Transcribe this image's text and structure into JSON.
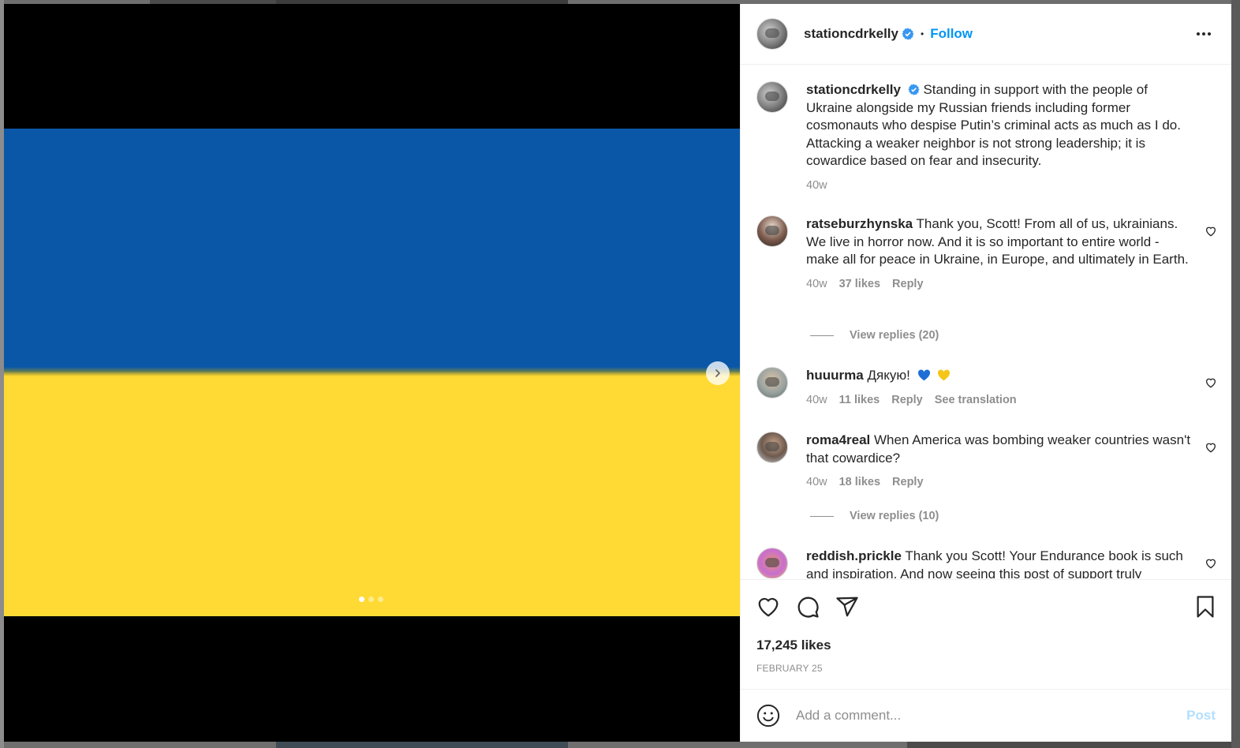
{
  "post": {
    "username": "stationcdrkelly",
    "follow_label": "Follow",
    "caption": "Standing in support with the people of Ukraine alongside my Russian friends including former cosmonauts who despise Putin’s criminal acts as much as I do. Attacking a weaker neighbor is not strong leadership; it is cowardice based on fear and insecurity.",
    "caption_time": "40w",
    "likes": "17,245 likes",
    "date": "FEBRUARY 25"
  },
  "media": {
    "slide_count": 3,
    "active_slide": 1,
    "flag_colors": {
      "top": "#0a57a8",
      "bottom": "#ffda34"
    }
  },
  "comments": [
    {
      "username": "ratseburzhynska",
      "text": "Thank you, Scott! From all of us, ukrainians. We live in horror now. And it is so important to entire world - make all for peace in Ukraine, in Europe, and ultimately in Earth.",
      "time": "40w",
      "likes": "37 likes",
      "reply": "Reply",
      "view_replies": "View replies (20)"
    },
    {
      "username": "huuurma",
      "text": "Дякую!",
      "time": "40w",
      "likes": "11 likes",
      "reply": "Reply",
      "translate": "See translation"
    },
    {
      "username": "roma4real",
      "text": "When America was bombing weaker countries wasn't that cowardice?",
      "time": "40w",
      "likes": "18 likes",
      "reply": "Reply",
      "view_replies": "View replies (10)"
    },
    {
      "username": "reddish.prickle",
      "text": "Thank you Scott! Your Endurance book is such and inspiration. And now seeing this post of support truly"
    }
  ],
  "add_comment": {
    "placeholder": "Add a comment...",
    "post_label": "Post"
  },
  "colors": {
    "accent": "#0095f6",
    "post_disabled": "#b2dffc",
    "secondary_text": "#8e8e8e"
  },
  "icons": [
    "verified-badge-icon",
    "more-options-icon",
    "heart-icon",
    "comment-icon",
    "share-icon",
    "bookmark-icon",
    "emoji-icon",
    "chevron-right-icon",
    "blue-heart-emoji",
    "yellow-heart-emoji"
  ]
}
